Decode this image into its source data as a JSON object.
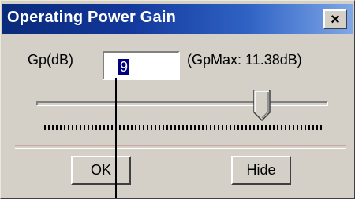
{
  "window": {
    "title": "Operating Power Gain",
    "close_label": "×"
  },
  "gain": {
    "label": "Gp(dB)",
    "value": "9",
    "max_label": "(GpMax: 11.38dB)"
  },
  "slider": {
    "value_fraction": 0.79
  },
  "buttons": {
    "ok_label": "OK",
    "hide_label": "Hide"
  },
  "colors": {
    "titlebar_start": "#0a2a7a",
    "titlebar_end": "#7fa7e8",
    "face": "#d4d0c8",
    "selection": "#000080"
  }
}
